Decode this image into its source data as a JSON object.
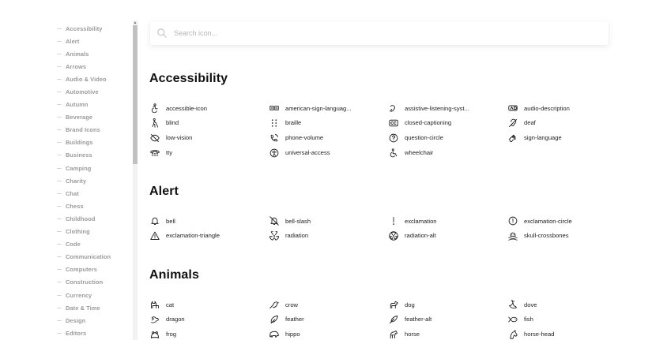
{
  "sidebar": {
    "categories": [
      "Accessibility",
      "Alert",
      "Animals",
      "Arrows",
      "Audio & Video",
      "Automotive",
      "Autumn",
      "Beverage",
      "Brand Icons",
      "Buildings",
      "Business",
      "Camping",
      "Charity",
      "Chat",
      "Chess",
      "Childhood",
      "Clothing",
      "Code",
      "Communication",
      "Computers",
      "Construction",
      "Currency",
      "Date & Time",
      "Design",
      "Editors"
    ]
  },
  "search": {
    "placeholder": "Search icon..."
  },
  "sections": [
    {
      "title": "Accessibility",
      "icons": [
        {
          "name": "accessible-icon",
          "icon": "accessible-icon"
        },
        {
          "name": "american-sign-languag...",
          "icon": "american-sign-language-icon"
        },
        {
          "name": "assistive-listening-syst...",
          "icon": "assistive-listening-systems-icon"
        },
        {
          "name": "audio-description",
          "icon": "audio-description-icon"
        },
        {
          "name": "blind",
          "icon": "blind-icon"
        },
        {
          "name": "braille",
          "icon": "braille-icon"
        },
        {
          "name": "closed-captioning",
          "icon": "closed-captioning-icon"
        },
        {
          "name": "deaf",
          "icon": "deaf-icon"
        },
        {
          "name": "low-vision",
          "icon": "low-vision-icon"
        },
        {
          "name": "phone-volume",
          "icon": "phone-volume-icon"
        },
        {
          "name": "question-circle",
          "icon": "question-circle-icon"
        },
        {
          "name": "sign-language",
          "icon": "sign-language-icon"
        },
        {
          "name": "tty",
          "icon": "tty-icon"
        },
        {
          "name": "universal-access",
          "icon": "universal-access-icon"
        },
        {
          "name": "wheelchair",
          "icon": "wheelchair-icon"
        }
      ]
    },
    {
      "title": "Alert",
      "icons": [
        {
          "name": "bell",
          "icon": "bell-icon"
        },
        {
          "name": "bell-slash",
          "icon": "bell-slash-icon"
        },
        {
          "name": "exclamation",
          "icon": "exclamation-icon"
        },
        {
          "name": "exclamation-circle",
          "icon": "exclamation-circle-icon"
        },
        {
          "name": "exclamation-triangle",
          "icon": "exclamation-triangle-icon"
        },
        {
          "name": "radiation",
          "icon": "radiation-icon"
        },
        {
          "name": "radiation-alt",
          "icon": "radiation-alt-icon"
        },
        {
          "name": "skull-crossbones",
          "icon": "skull-crossbones-icon"
        }
      ]
    },
    {
      "title": "Animals",
      "icons": [
        {
          "name": "cat",
          "icon": "cat-icon"
        },
        {
          "name": "crow",
          "icon": "crow-icon"
        },
        {
          "name": "dog",
          "icon": "dog-icon"
        },
        {
          "name": "dove",
          "icon": "dove-icon"
        },
        {
          "name": "dragon",
          "icon": "dragon-icon"
        },
        {
          "name": "feather",
          "icon": "feather-icon"
        },
        {
          "name": "feather-alt",
          "icon": "feather-alt-icon"
        },
        {
          "name": "fish",
          "icon": "fish-icon"
        },
        {
          "name": "frog",
          "icon": "frog-icon"
        },
        {
          "name": "hippo",
          "icon": "hippo-icon"
        },
        {
          "name": "horse",
          "icon": "horse-icon"
        },
        {
          "name": "horse-head",
          "icon": "horse-head-icon"
        }
      ]
    }
  ]
}
